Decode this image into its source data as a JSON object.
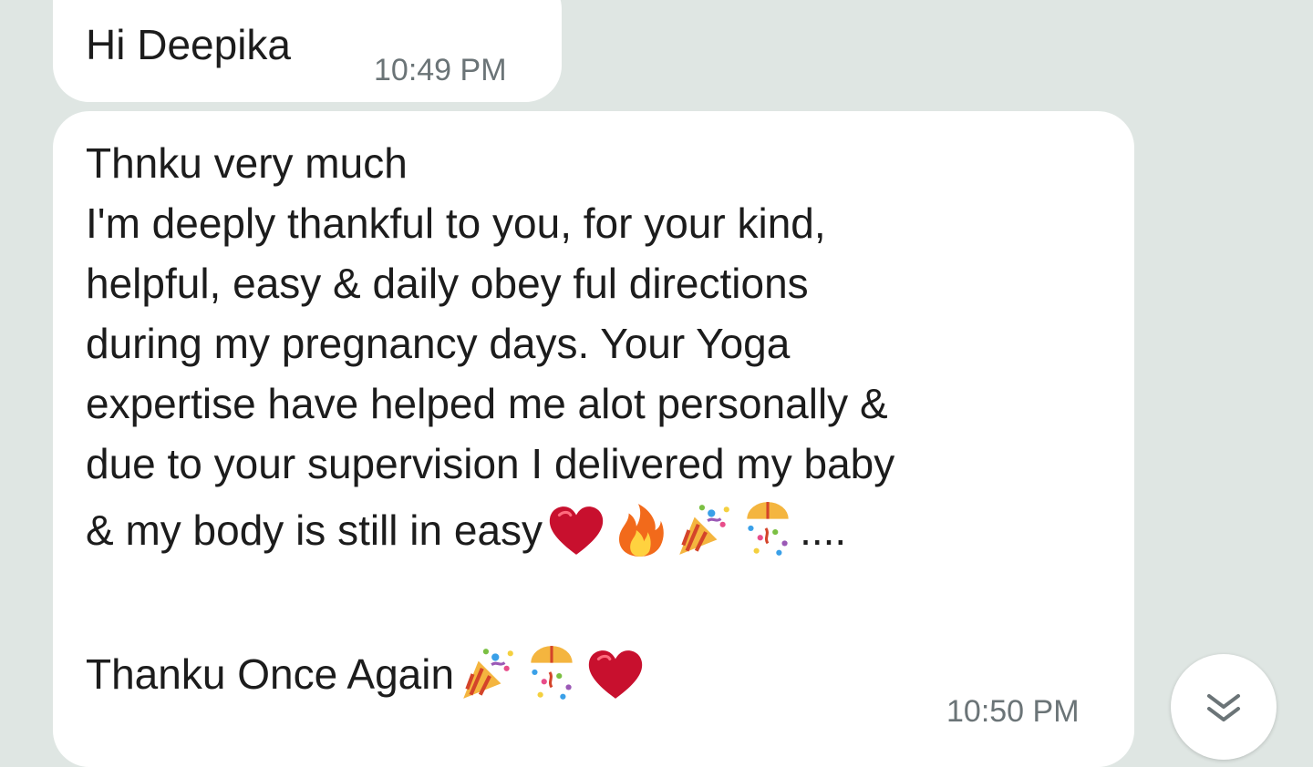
{
  "messages": [
    {
      "text": "Hi Deepika",
      "time": "10:49 PM"
    },
    {
      "lines": [
        "Thnku very much",
        "I'm deeply thankful to you, for your kind,",
        "helpful, easy & daily obey ful directions",
        "during my pregnancy days. Your Yoga",
        "expertise have helped me alot personally &",
        "due to your supervision  I delivered my baby",
        "& my body is still in easy"
      ],
      "line7_suffix": "....",
      "closing": "Thanku Once Again",
      "time": "10:50 PM",
      "emojis_line7": [
        "red-heart-icon",
        "fire-icon",
        "party-popper-icon",
        "confetti-ball-icon"
      ],
      "emojis_closing": [
        "party-popper-icon",
        "confetti-ball-icon",
        "red-heart-icon"
      ]
    }
  ],
  "colors": {
    "chat_background": "#dfe6e3",
    "bubble": "#ffffff",
    "timestamp": "#6b7477"
  },
  "scroll_button": {
    "icon": "double-chevron-down-icon"
  }
}
